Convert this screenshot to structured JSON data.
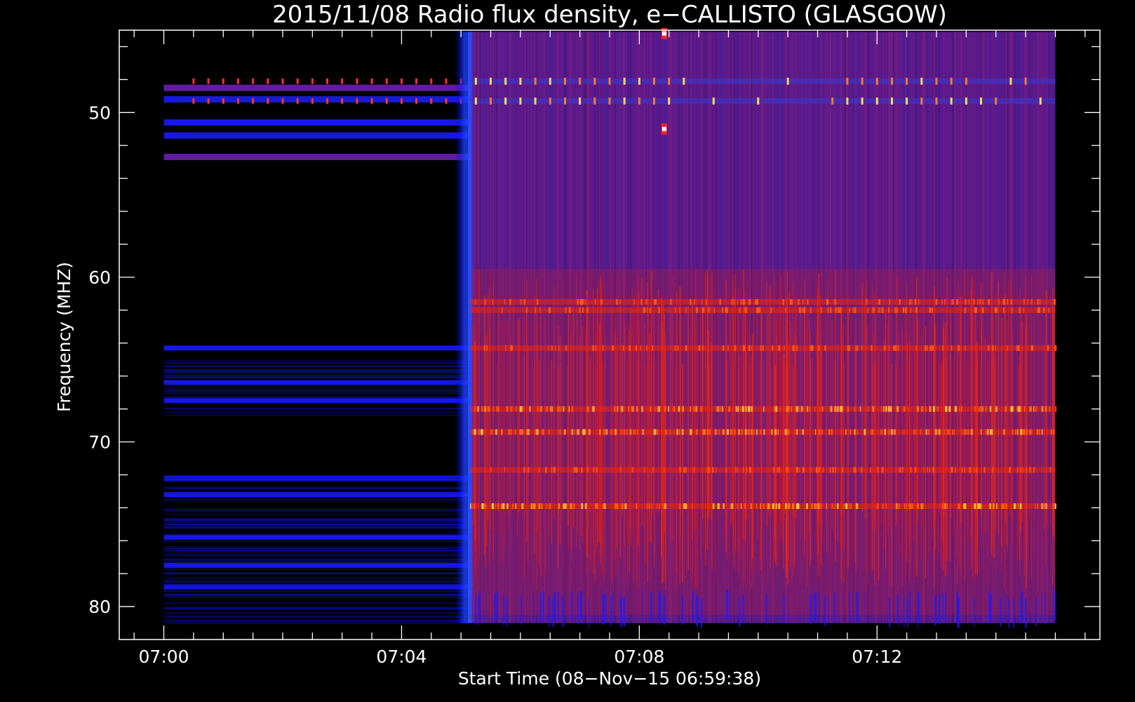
{
  "chart_data": {
    "type": "heatmap",
    "title": "2015/11/08  Radio flux density, e−CALLISTO (GLASGOW)",
    "xlabel": "Start Time (08−Nov−15 06:59:38)",
    "ylabel": "Frequency (MHZ)",
    "x_ticks": [
      "07:00",
      "07:04",
      "07:08",
      "07:12"
    ],
    "x_tick_minutes": [
      0,
      4,
      8,
      12
    ],
    "xlim_minutes": [
      -0.75,
      15.75
    ],
    "data_x_range_minutes": [
      0,
      15
    ],
    "y_ticks": [
      50,
      60,
      70,
      80
    ],
    "ylim": [
      45,
      82
    ],
    "data_y_range": [
      45.1,
      81.0
    ],
    "y_inverted": true,
    "colormap": "black-blue-red-yellow-white",
    "colors": {
      "background": "#000000",
      "quiet_band": "#1a1aff",
      "active_noise": "#5a1a8c",
      "strong_emission": "#ff2a00",
      "peak": "#ffd84a"
    },
    "events": {
      "receiver_turn_on_minutes": 5.15,
      "pre_on_bands_mhz": [
        48.5,
        49.2,
        50.6,
        51.4,
        52.7,
        64.3,
        66.4,
        67.5,
        72.2,
        73.2,
        75.8,
        77.5,
        78.8
      ],
      "post_on_red_bands_mhz": [
        61.5,
        62.0,
        64.3,
        68.0,
        69.4,
        71.7,
        73.9
      ],
      "bursts": [
        {
          "t_minutes": 8.42,
          "f_mhz": 51.0
        },
        {
          "t_minutes": 8.42,
          "f_mhz": 45.2
        }
      ]
    }
  }
}
